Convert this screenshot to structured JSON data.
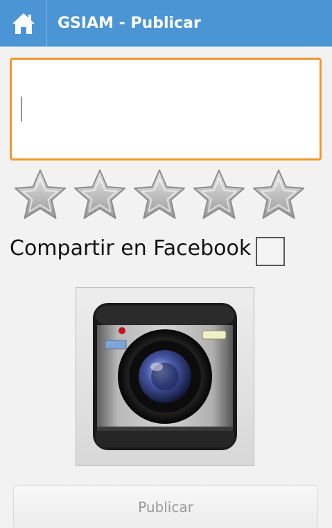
{
  "header": {
    "title": "GSIAM - Publicar",
    "home_icon": "home-icon",
    "background_color": "#4c95d5"
  },
  "post_input": {
    "value": "",
    "placeholder": "",
    "focus_border_color": "#f0982a"
  },
  "rating": {
    "max": 5,
    "value": 0,
    "star_icon": "star-icon"
  },
  "facebook_share": {
    "label": "Compartir en Facebook",
    "checked": false
  },
  "camera": {
    "icon": "camera-icon"
  },
  "publish": {
    "label": "Publicar"
  }
}
